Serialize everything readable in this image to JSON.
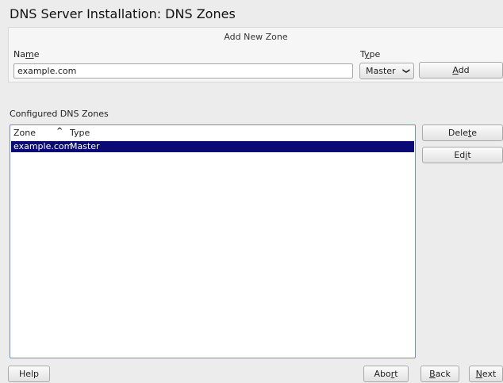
{
  "window": {
    "title": "DNS Server Installation: DNS Zones"
  },
  "add_zone": {
    "group_title": "Add New Zone",
    "name_label_pre": "Na",
    "name_label_ul": "m",
    "name_label_post": "e",
    "name_value": "example.com",
    "type_label_pre": "T",
    "type_label_ul": "y",
    "type_label_post": "pe",
    "type_selected": "Master",
    "add_ul": "A",
    "add_rest": "dd"
  },
  "zones": {
    "section_label": "Configured DNS Zones",
    "columns": [
      "Zone",
      "Type"
    ],
    "rows": [
      {
        "zone": "example.com",
        "type": "Master"
      }
    ],
    "delete_pre": "Dele",
    "delete_ul": "t",
    "delete_post": "e",
    "edit_pre": "Ed",
    "edit_ul": "i",
    "edit_post": "t"
  },
  "footer": {
    "help": "Help",
    "abort_pre": "Abo",
    "abort_ul": "r",
    "abort_post": "t",
    "back_ul": "B",
    "back_rest": "ack",
    "next_ul": "N",
    "next_rest": "ext"
  }
}
